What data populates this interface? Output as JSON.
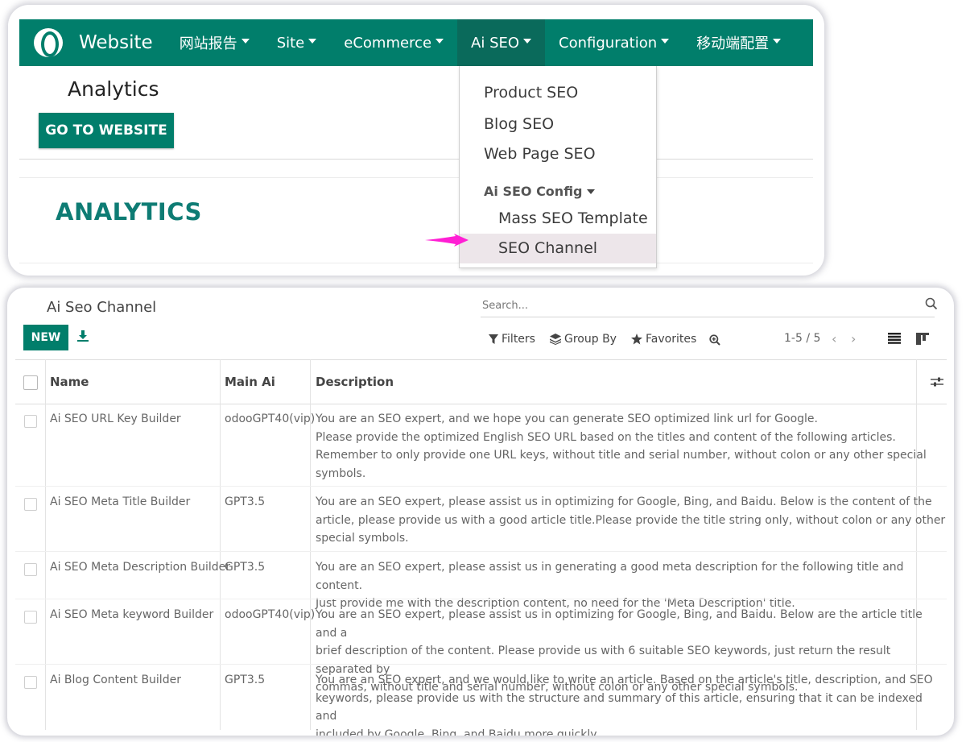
{
  "navbar": {
    "brand": "Website",
    "menus": [
      "网站报告",
      "Site",
      "eCommerce",
      "Ai SEO",
      "Configuration",
      "移动端配置"
    ]
  },
  "page": {
    "analytics_label": "Analytics",
    "goto_button": "GO TO WEBSITE",
    "heading": "ANALYTICS"
  },
  "dropdown": {
    "items": [
      "Product SEO",
      "Blog SEO",
      "Web Page SEO"
    ],
    "section": "Ai SEO Config",
    "sub_items": [
      "Mass SEO Template",
      "SEO Channel"
    ]
  },
  "list_view": {
    "title": "Ai Seo Channel",
    "search_placeholder": "Search...",
    "new_button": "NEW",
    "filters": "Filters",
    "group_by": "Group By",
    "favorites": "Favorites",
    "pager": "1-5 / 5",
    "columns": [
      "Name",
      "Main Ai",
      "Description"
    ],
    "rows": [
      {
        "name": "Ai SEO URL Key Builder",
        "main_ai": "odooGPT40(vip)",
        "description": [
          "You are an SEO expert, and we hope you can generate SEO optimized link url for Google.",
          "Please provide the optimized English SEO URL based on the titles and content of the following articles.",
          "Remember to only provide one URL keys, without title and serial number, without colon or any other special",
          "symbols."
        ]
      },
      {
        "name": "Ai SEO Meta Title Builder",
        "main_ai": "GPT3.5",
        "description": [
          "You are an SEO expert, please assist us in optimizing for Google, Bing, and Baidu. Below is the content of the",
          "article, please provide us with a good article title.Please provide the title string only, without colon or any other",
          "special symbols."
        ]
      },
      {
        "name": "Ai SEO Meta Description Builder",
        "main_ai": "GPT3.5",
        "description": [
          "You are an SEO expert, please assist us in generating a good meta description for the following title and content.",
          "Just provide me with the description content, no need for the 'Meta Description' title."
        ]
      },
      {
        "name": "Ai SEO Meta keyword Builder",
        "main_ai": "odooGPT40(vip)",
        "description": [
          "You are an SEO expert, please assist us in optimizing for Google, Bing, and Baidu. Below are the article title and a",
          "brief description of the content. Please provide us with 6 suitable SEO keywords, just return the result separated by",
          "commas, without title and serial number, without colon or any other special symbols."
        ]
      },
      {
        "name": "Ai Blog Content Builder",
        "main_ai": "GPT3.5",
        "description": [
          "You are an SEO expert, and we would like to write an article. Based on the article's title, description, and SEO",
          "keywords, please provide us with the structure and summary of this article, ensuring that it can be indexed and",
          "included by Google, Bing, and Baidu more quickly."
        ]
      }
    ]
  },
  "colors": {
    "brand": "#017e6b",
    "active_menu": "#0a6a5b",
    "heading": "#0e7c74",
    "arrow": "#ff1fd4",
    "hover": "#ede6ea"
  }
}
